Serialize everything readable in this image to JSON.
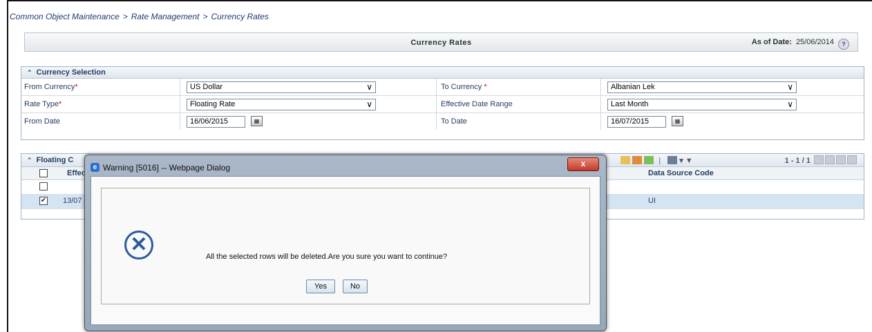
{
  "breadcrumb": [
    "Common Object Maintenance",
    "Rate Management",
    "Currency Rates"
  ],
  "breadcrumb_separator": ">",
  "page": {
    "title": "Currency Rates",
    "as_of_label": "As of Date:",
    "as_of_date": "25/06/2014"
  },
  "currency_selection": {
    "header": "Currency Selection",
    "from_currency_label": "From Currency",
    "from_currency_value": "US Dollar",
    "to_currency_label": "To Currency ",
    "to_currency_value": "Albanian Lek",
    "rate_type_label": "Rate Type",
    "rate_type_value": "Floating Rate",
    "effective_range_label": "Effective Date Range",
    "effective_range_value": "Last Month",
    "from_date_label": "From Date",
    "from_date_value": "16/06/2015",
    "to_date_label": "To Date",
    "to_date_value": "16/07/2015",
    "required_mark": "*"
  },
  "grid": {
    "header_partial": "Floating C",
    "col_effective_partial": "Effec",
    "col_data_source": "Data Source Code",
    "row_selected_date_partial": "13/07",
    "row_selected_source": "UI",
    "pager": "1 - 1 / 1"
  },
  "dialog": {
    "title": "Warning [5016] -- Webpage Dialog",
    "close_label": "x",
    "message": "All the selected rows will be deleted.Are you sure you want to continue?",
    "yes_label": "Yes",
    "no_label": "No"
  },
  "icons": {
    "help": "help-icon",
    "calendar": "calendar-icon",
    "error": "error-x-icon",
    "browser": "ie-icon"
  },
  "colors": {
    "breadcrumb": "#1f3b6e",
    "required": "#ee0000",
    "selected_row": "#d5e4f2",
    "dialog_frame": "#96a8ba",
    "error_icon": "#2d5a9c"
  }
}
